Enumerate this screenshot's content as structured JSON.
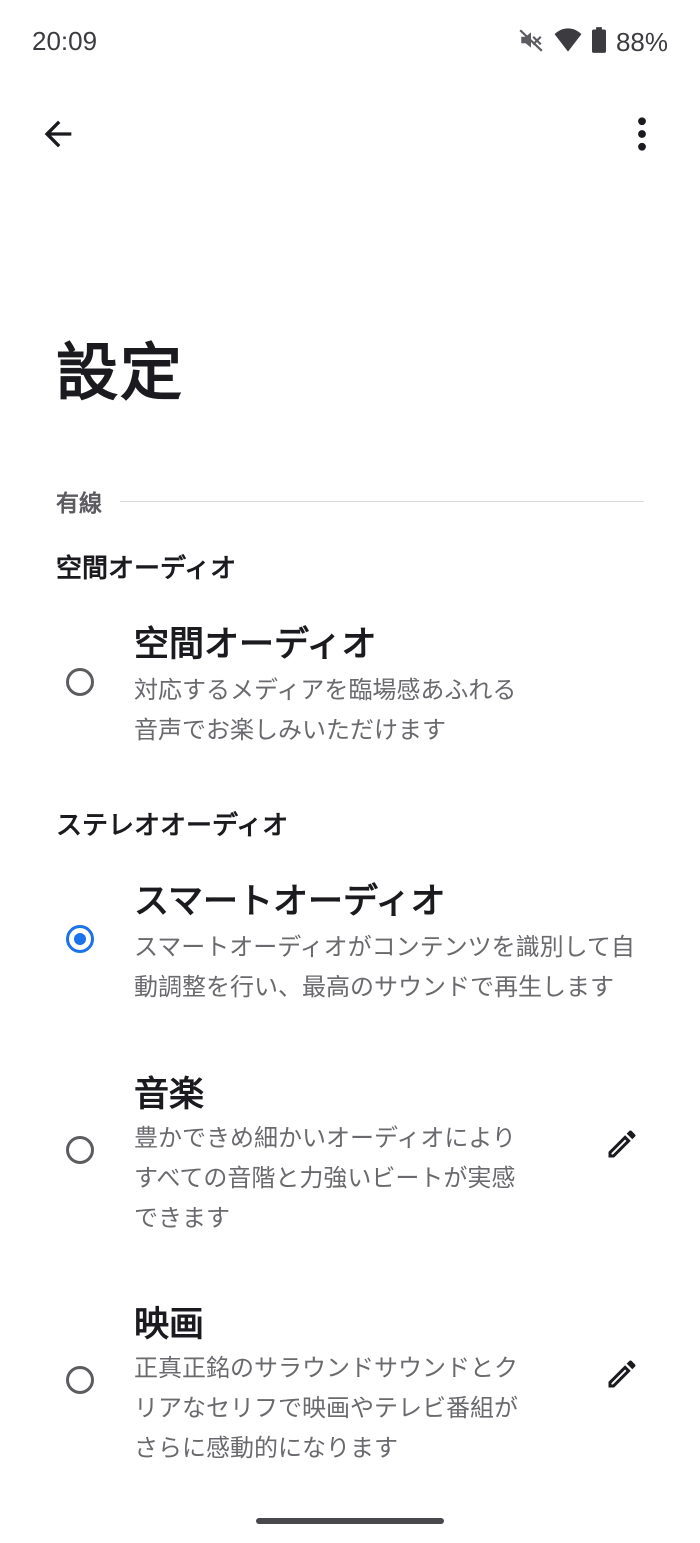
{
  "status_bar": {
    "time": "20:09",
    "battery": "88%",
    "icons": [
      "mute-icon",
      "wifi-icon",
      "battery-icon"
    ]
  },
  "toolbar": {
    "back_icon": "arrow-back-icon",
    "more_icon": "more-vert-icon"
  },
  "page": {
    "title": "設定"
  },
  "sections": {
    "wired_label": "有線",
    "spatial_category": "空間オーディオ",
    "stereo_category": "ステレオオーディオ"
  },
  "options": [
    {
      "title": "空間オーディオ",
      "desc": [
        "対応するメディアを臨場感あふれる",
        "音声でお楽しみいただけます"
      ],
      "selected": false,
      "editable": false
    },
    {
      "title": "スマートオーディオ",
      "desc": [
        "スマートオーディオがコンテンツを識別して自",
        "動調整を行い、最高のサウンドで再生します"
      ],
      "selected": true,
      "editable": false
    },
    {
      "title": "音楽",
      "desc": [
        "豊かできめ細かいオーディオにより",
        "すべての音階と力強いビートが実感",
        "できます"
      ],
      "selected": false,
      "editable": true
    },
    {
      "title": "映画",
      "desc": [
        "正真正銘のサラウンドサウンドとク",
        "リアなセリフで映画やテレビ番組が",
        "さらに感動的になります"
      ],
      "selected": false,
      "editable": true
    }
  ],
  "colors": {
    "accent": "#1a73e8",
    "text_primary": "#1b1b1f",
    "text_secondary": "#6a6a6e"
  }
}
